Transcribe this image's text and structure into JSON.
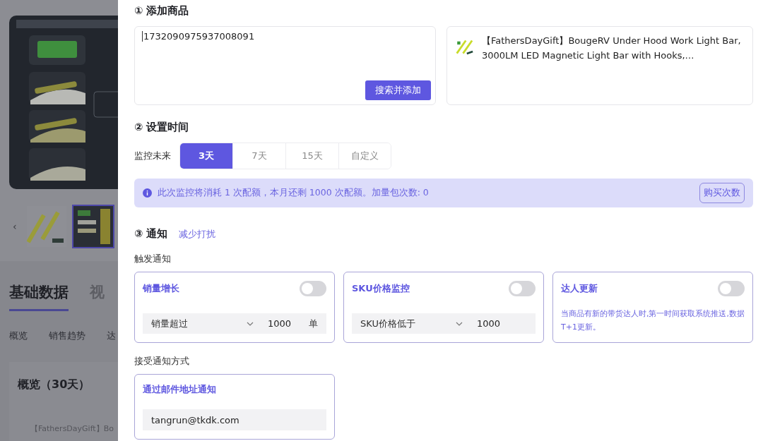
{
  "background": {
    "prev_arrow": "‹",
    "thumbnails": [
      {
        "selected": false
      },
      {
        "selected": true
      }
    ],
    "tabs": [
      {
        "label": "基础数据",
        "selected": true
      },
      {
        "label": "视",
        "selected": false
      }
    ],
    "subtabs": [
      "概览",
      "销售趋势",
      "达"
    ],
    "overview_title": "概览（30天）",
    "product_snippet": "【FathersDayGift】Bo"
  },
  "drawer": {
    "add_product": {
      "title": "① 添加商品",
      "input_value": "1732090975937008091",
      "search_button": "搜索并添加",
      "product": {
        "name": "【FathersDayGift】BougeRV Under Hood Work Light Bar, 3000LM LED Magnetic Light Bar with Hooks,…"
      }
    },
    "timing": {
      "title": "② 设置时间",
      "label": "监控未来",
      "options": [
        {
          "label": "3天",
          "selected": true
        },
        {
          "label": "7天",
          "selected": false
        },
        {
          "label": "15天",
          "selected": false
        },
        {
          "label": "自定义",
          "selected": false
        }
      ],
      "notice": "此次监控将消耗 1 次配额，本月还剩 1000 次配额。加量包次数: 0",
      "buy_button": "购买次数"
    },
    "notify": {
      "title": "③ 通知",
      "link": "减少打扰",
      "trigger_label": "触发通知",
      "triggers": [
        {
          "kind": "threshold",
          "title": "销量增长",
          "on": false,
          "condition": "销量超过",
          "value": "1000",
          "unit": "单"
        },
        {
          "kind": "threshold",
          "title": "SKU价格监控",
          "on": false,
          "condition": "SKU价格低于",
          "value": "1000"
        },
        {
          "kind": "info",
          "title": "达人更新",
          "on": false,
          "description": "当商品有新的带货达人时,第一时间获取系统推送,数据T+1更新。"
        }
      ],
      "receive_label": "接受通知方式",
      "channels": [
        {
          "title": "通过邮件地址通知",
          "value": "tangrun@tkdk.com"
        }
      ]
    }
  }
}
